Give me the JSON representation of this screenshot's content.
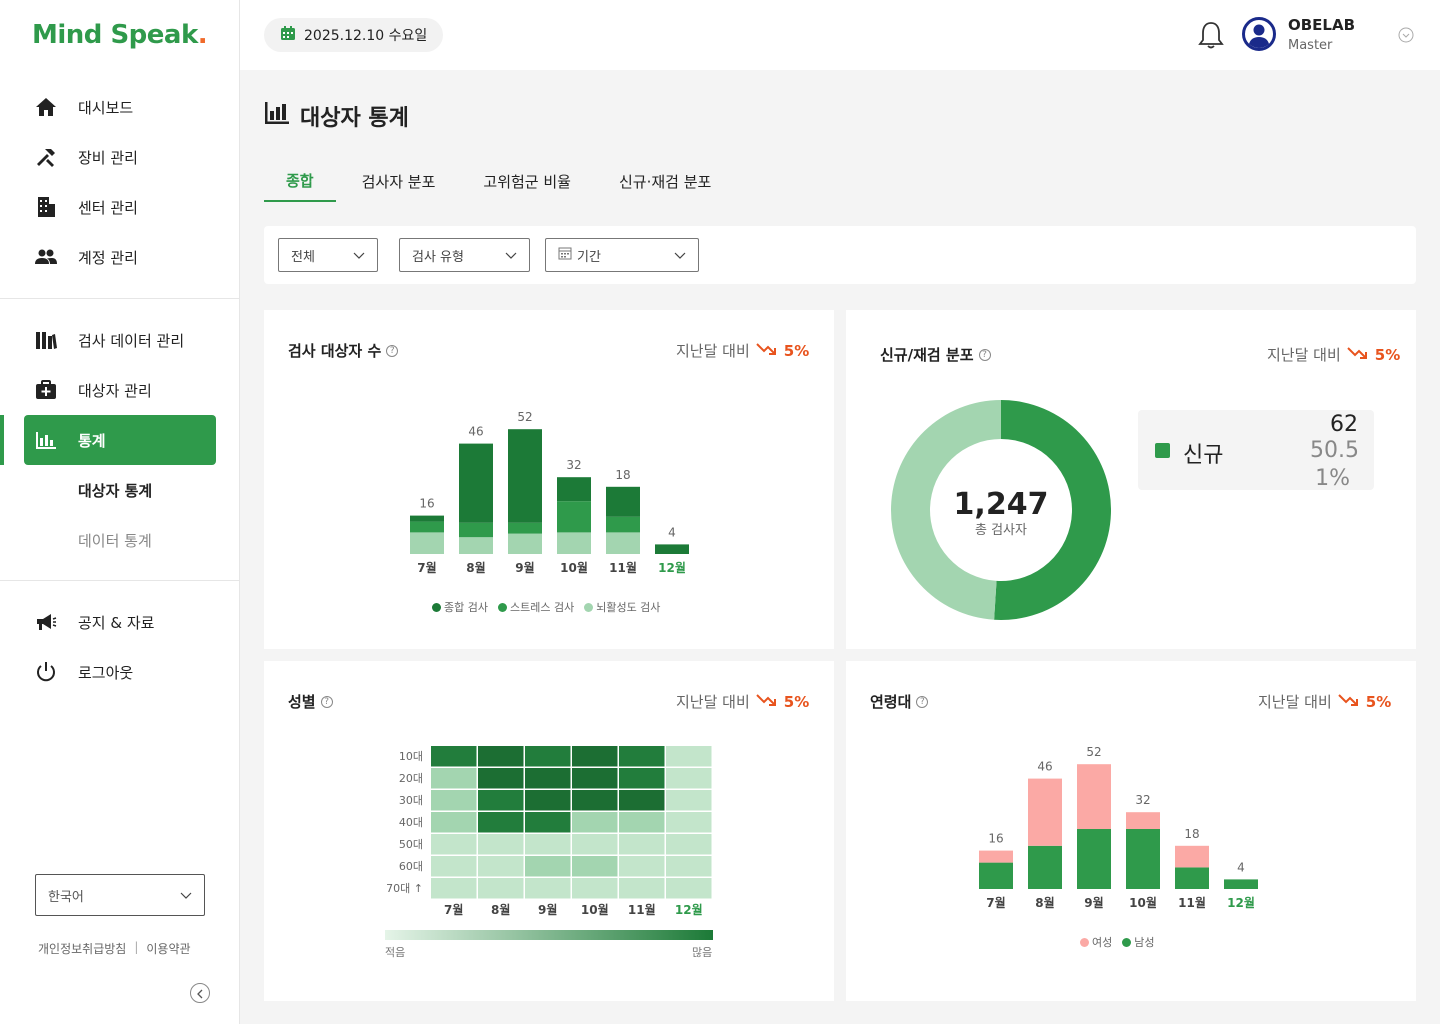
{
  "brand": {
    "logo": "Mind Speak",
    "logo_dot": "."
  },
  "sidebar": {
    "main_items": [
      {
        "label": "대시보드",
        "icon": "home-icon"
      },
      {
        "label": "장비 관리",
        "icon": "tools-icon"
      },
      {
        "label": "센터 관리",
        "icon": "building-icon"
      },
      {
        "label": "계정 관리",
        "icon": "users-icon"
      }
    ],
    "data_items": [
      {
        "label": "검사 데이터 관리",
        "icon": "library-icon"
      },
      {
        "label": "대상자 관리",
        "icon": "medkit-icon"
      },
      {
        "label": "통계",
        "icon": "bar-chart-icon"
      }
    ],
    "sub_items": [
      {
        "label": "대상자 통계"
      },
      {
        "label": "데이터 통계"
      }
    ],
    "bottom_items": [
      {
        "label": "공지 & 자료",
        "icon": "megaphone-icon"
      },
      {
        "label": "로그아웃",
        "icon": "power-icon"
      }
    ],
    "language": "한국어",
    "privacy_label": "개인정보취급방침",
    "terms_label": "이용약관"
  },
  "header": {
    "date": "2025.12.10 수요일",
    "user_name": "OBELAB",
    "user_role": "Master"
  },
  "page": {
    "title": "대상자 통계"
  },
  "tabs": [
    {
      "label": "종합"
    },
    {
      "label": "검사자 분포"
    },
    {
      "label": "고위험군 비율"
    },
    {
      "label": "신규·재검 분포"
    }
  ],
  "filters": {
    "scope": "전체",
    "test_type": "검사 유형",
    "period": "기간"
  },
  "compare_label": "지난달 대비",
  "compare_value": "5%",
  "colors": {
    "primary": "#2f9a4b",
    "dark": "#1c7a37",
    "light": "#a3d5b0",
    "female": "#fba9a5",
    "down": "#e8541e"
  },
  "cards": {
    "subjects": {
      "title": "검사 대상자 수"
    },
    "new_repeat": {
      "title": "신규/재검 분포"
    },
    "gender": {
      "title": "성별"
    },
    "age": {
      "title": "연령대"
    }
  },
  "chart_data": [
    {
      "type": "bar",
      "title": "검사 대상자 수",
      "categories": [
        "7월",
        "8월",
        "9월",
        "10월",
        "11월",
        "12월"
      ],
      "totals": [
        16,
        46,
        52,
        32,
        18,
        4
      ],
      "series": [
        {
          "name": "종합 검사",
          "values": [
            2.5,
            33,
            39,
            10,
            12.5,
            4
          ]
        },
        {
          "name": "스트레스 검사",
          "values": [
            4.5,
            6,
            4.5,
            13,
            6.5,
            0
          ]
        },
        {
          "name": "뇌활성도 검사",
          "values": [
            9,
            7,
            8.5,
            9,
            9,
            0
          ]
        }
      ],
      "ylim": [
        0,
        60
      ]
    },
    {
      "type": "pie",
      "title": "신규/재검 분포",
      "center_value": "1,247",
      "center_label": "총 검사자",
      "labels": [
        "신규",
        ""
      ],
      "values": [
        51,
        49
      ],
      "legend": [
        {
          "label": "신규",
          "count": "62",
          "pct": "50.5 1%"
        }
      ]
    },
    {
      "type": "heatmap",
      "title": "성별",
      "rows": [
        "10대",
        "20대",
        "30대",
        "40대",
        "50대",
        "60대",
        "70대 ↑"
      ],
      "cols": [
        "7월",
        "8월",
        "9월",
        "10월",
        "11월",
        "12월"
      ],
      "values": [
        [
          4,
          5,
          4,
          5,
          4,
          1
        ],
        [
          2,
          5,
          5,
          5,
          4,
          1
        ],
        [
          2,
          4,
          5,
          5,
          5,
          1
        ],
        [
          2,
          4,
          4,
          2,
          2,
          1
        ],
        [
          1,
          1,
          1,
          1,
          1,
          1
        ],
        [
          1,
          1,
          2,
          2,
          1,
          1
        ],
        [
          1,
          1,
          1,
          1,
          1,
          1
        ]
      ],
      "scale_low": "적음",
      "scale_high": "많음"
    },
    {
      "type": "bar",
      "title": "연령대",
      "categories": [
        "7월",
        "8월",
        "9월",
        "10월",
        "11월",
        "12월"
      ],
      "totals": [
        16,
        46,
        52,
        32,
        18,
        4
      ],
      "series": [
        {
          "name": "여성",
          "values": [
            5,
            28,
            27,
            7,
            9,
            0
          ]
        },
        {
          "name": "남성",
          "values": [
            11,
            18,
            25,
            25,
            9,
            4
          ]
        }
      ],
      "ylim": [
        0,
        60
      ]
    }
  ]
}
